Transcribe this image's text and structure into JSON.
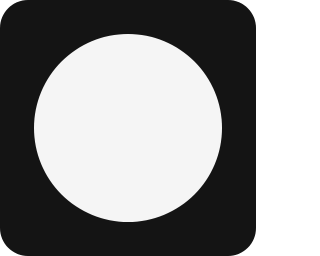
{
  "icon": {
    "name": "circle-app-icon",
    "background_color": "#141414",
    "glyph_color": "#f5f5f5"
  }
}
